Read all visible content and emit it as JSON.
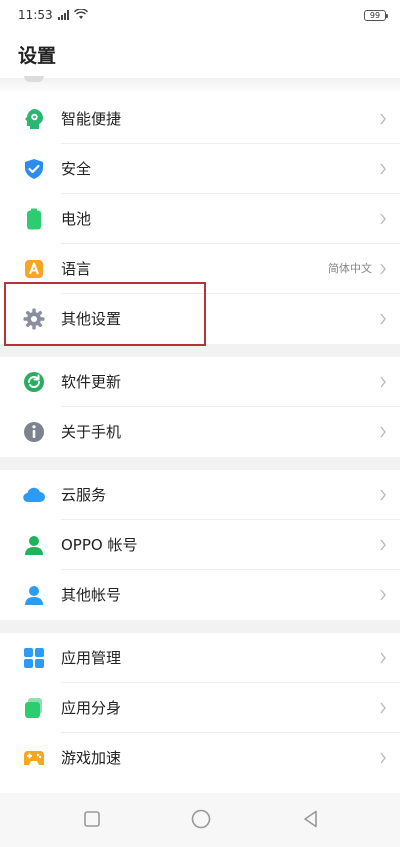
{
  "status_bar": {
    "time": "11:53",
    "battery": "99",
    "signal_icon": "signal-icon",
    "wifi_icon": "wifi-icon"
  },
  "page": {
    "title": "设置"
  },
  "groups": [
    {
      "items": [
        {
          "id": "smart-shortcut",
          "label": "智能便捷",
          "icon": "smart-assist-icon",
          "color": "#2bb673",
          "value": ""
        },
        {
          "id": "security",
          "label": "安全",
          "icon": "shield-icon",
          "color": "#2d8cf0",
          "value": ""
        },
        {
          "id": "battery",
          "label": "电池",
          "icon": "battery-icon",
          "color": "#2ecc71",
          "value": ""
        },
        {
          "id": "language",
          "label": "语言",
          "icon": "language-icon",
          "color": "#f5a623",
          "value": "简体中文"
        },
        {
          "id": "other-settings",
          "label": "其他设置",
          "icon": "gear-icon",
          "color": "#8a8fa0",
          "value": ""
        }
      ]
    },
    {
      "items": [
        {
          "id": "software-update",
          "label": "软件更新",
          "icon": "update-icon",
          "color": "#27ae60",
          "value": ""
        },
        {
          "id": "about-phone",
          "label": "关于手机",
          "icon": "info-icon",
          "color": "#7d8290",
          "value": ""
        }
      ]
    },
    {
      "items": [
        {
          "id": "cloud-service",
          "label": "云服务",
          "icon": "cloud-icon",
          "color": "#2d9cf0",
          "value": ""
        },
        {
          "id": "oppo-account",
          "label": "OPPO 帐号",
          "icon": "user-icon",
          "color": "#1fb25a",
          "value": ""
        },
        {
          "id": "other-accounts",
          "label": "其他帐号",
          "icon": "user-icon",
          "color": "#2d9cf0",
          "value": ""
        }
      ]
    },
    {
      "items": [
        {
          "id": "app-management",
          "label": "应用管理",
          "icon": "apps-grid-icon",
          "color": "#2d9cf0",
          "value": ""
        },
        {
          "id": "app-clone",
          "label": "应用分身",
          "icon": "app-clone-icon",
          "color": "#2ecc71",
          "value": ""
        },
        {
          "id": "game-boost",
          "label": "游戏加速",
          "icon": "gamepad-icon",
          "color": "#f5a623",
          "value": ""
        }
      ]
    }
  ],
  "nav_bar": {
    "recents_icon": "square-recents-icon",
    "home_icon": "circle-home-icon",
    "back_icon": "triangle-back-icon"
  }
}
